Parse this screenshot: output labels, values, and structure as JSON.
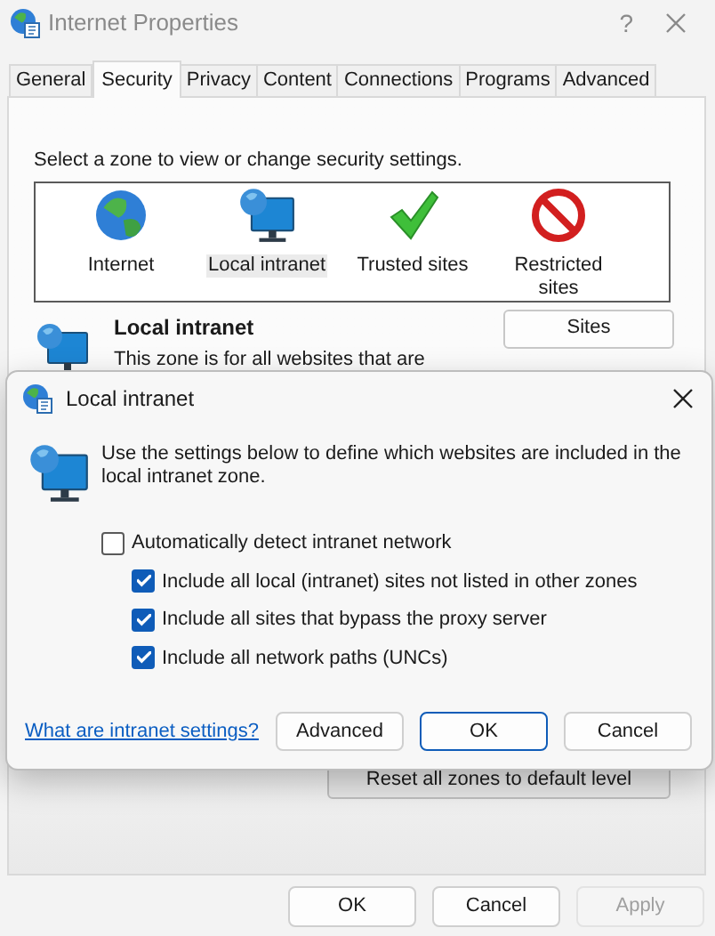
{
  "window": {
    "title": "Internet Properties",
    "help": "?"
  },
  "tabs": [
    {
      "label": "General",
      "selected": false
    },
    {
      "label": "Security",
      "selected": true
    },
    {
      "label": "Privacy",
      "selected": false
    },
    {
      "label": "Content",
      "selected": false
    },
    {
      "label": "Connections",
      "selected": false
    },
    {
      "label": "Programs",
      "selected": false
    },
    {
      "label": "Advanced",
      "selected": false
    }
  ],
  "security": {
    "prompt": "Select a zone to view or change security settings.",
    "zones": [
      {
        "label": "Internet",
        "kind": "internet",
        "selected": false
      },
      {
        "label": "Local intranet",
        "kind": "intranet",
        "selected": true
      },
      {
        "label": "Trusted sites",
        "kind": "trusted",
        "selected": false
      },
      {
        "label": "Restricted sites",
        "kind": "restricted",
        "selected": false
      }
    ],
    "zone_title": "Local intranet",
    "zone_description": "This zone is for all websites that are",
    "sites_button": "Sites",
    "reset_button": "Reset all zones to default level"
  },
  "dialog": {
    "title": "Local intranet",
    "intro": "Use the settings below to define which websites are included in the local intranet zone.",
    "options": [
      {
        "label": "Automatically detect intranet network",
        "checked": false,
        "kind": "parent"
      },
      {
        "label": "Include all local (intranet) sites not listed in other zones",
        "checked": true,
        "kind": "child"
      },
      {
        "label": "Include all sites that bypass the proxy server",
        "checked": true,
        "kind": "child"
      },
      {
        "label": "Include all network paths (UNCs)",
        "checked": true,
        "kind": "child"
      }
    ],
    "link": "What are intranet settings?",
    "buttons": [
      {
        "label": "Advanced",
        "default": false
      },
      {
        "label": "OK",
        "default": true
      },
      {
        "label": "Cancel",
        "default": false
      }
    ]
  },
  "buttons": [
    {
      "label": "OK",
      "disabled": false
    },
    {
      "label": "Cancel",
      "disabled": false
    },
    {
      "label": "Apply",
      "disabled": true
    }
  ]
}
